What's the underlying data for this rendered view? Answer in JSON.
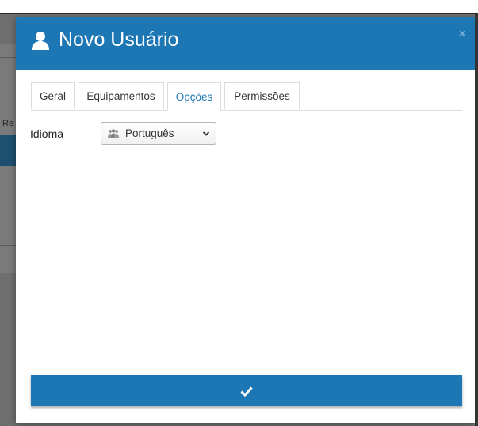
{
  "background": {
    "partial_text": "Re"
  },
  "modal": {
    "title": "Novo Usuário",
    "title_icon": "user-icon",
    "close_label": "×",
    "header_color": "#1d77b5"
  },
  "tabs": [
    {
      "label": "Geral",
      "active": false
    },
    {
      "label": "Equipamentos",
      "active": false
    },
    {
      "label": "Opções",
      "active": true
    },
    {
      "label": "Permissões",
      "active": false
    }
  ],
  "form": {
    "language_label": "Idioma",
    "language_value": "Português",
    "language_icon": "people-icon"
  },
  "submit": {
    "icon": "check-icon",
    "color": "#1d77b5"
  }
}
